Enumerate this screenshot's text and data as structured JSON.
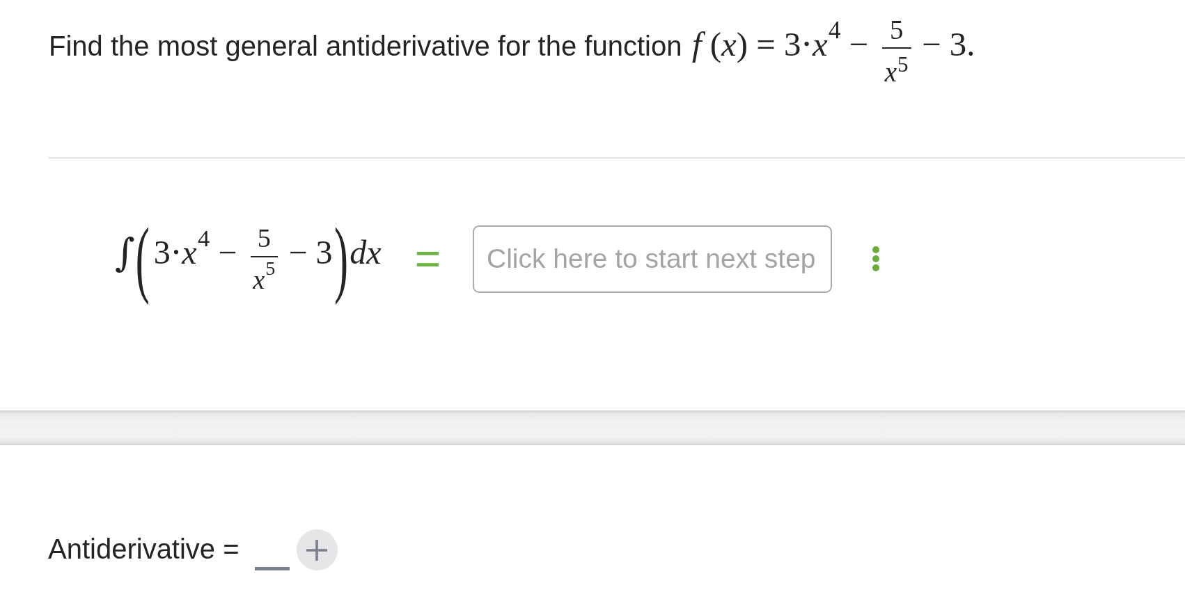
{
  "question": {
    "text": "Find the most general antiderivative for the function",
    "formula": [
      {
        "kind": "text",
        "text": "*f* (*x*) = 3⋅*x*$^{4}$ −"
      },
      {
        "kind": "fraction",
        "numerator": "5",
        "denominator": "*x*$^{5}$"
      },
      {
        "kind": "text",
        "text": "− 3."
      }
    ]
  },
  "step": {
    "integral": {
      "sign": "∫",
      "open": "(",
      "terms": [
        {
          "kind": "text",
          "text": "3⋅*x*$^{4}$ −"
        },
        {
          "kind": "fraction",
          "numerator": "5",
          "denominator": "*x*$^{5}$"
        },
        {
          "kind": "text",
          "text": "− 3"
        }
      ],
      "close": ")",
      "differential": "dx"
    },
    "relation": "=",
    "input": {
      "placeholder": "Click here to start next step"
    }
  },
  "answer": {
    "label": "Antiderivative =",
    "items": [
      {
        "kind": "blank"
      },
      {
        "kind": "add_button"
      }
    ]
  }
}
